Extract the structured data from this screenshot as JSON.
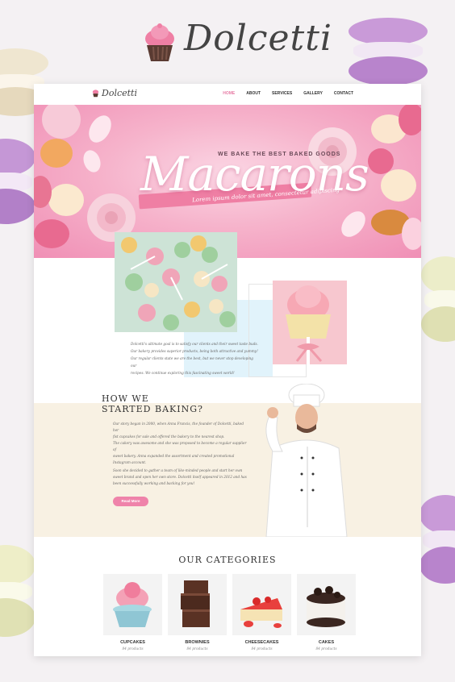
{
  "brand": {
    "name": "Dolcetti",
    "icon": "cupcake-icon"
  },
  "nav": {
    "logo": "Dolcetti",
    "links": [
      "HOME",
      "ABOUT",
      "SERVICES",
      "GALLERY",
      "CONTACT"
    ],
    "active": "HOME"
  },
  "hero": {
    "subtitle": "WE BAKE THE BEST BAKED GOODS",
    "title": "Macarons",
    "tagline": "Lorem ipsum dolor sit amet, consectetur adipiscing"
  },
  "about": {
    "lines": [
      "Dolcetti's ultimate goal is to satisfy our clients and their sweet taste buds.",
      "Our bakery provides superior products, being both attractive and yummy!",
      "Our regular clients state we are the best, but we never stop developing our",
      "recipes. We continue exploring this fascinating sweet world!"
    ]
  },
  "story": {
    "title_line1": "HOW WE",
    "title_line2": "STARTED BAKING?",
    "p1": [
      "Our story began in 2000, when Anna Francis, the founder of Dolcetti, baked her",
      "fist cupcakes for sale and offered the bakery to the nearest shop."
    ],
    "p2": [
      "The cakery was awesome and she was proposed to become a regular supplier of",
      "sweet bakery. Anna expanded the assortment and created promotional",
      "Instagram account."
    ],
    "p3": [
      "Soon she decided to gather a team of like-minded people and start her own",
      "sweet brand and open her own store. Dolcetti itself appeared in 2012 and has",
      "been successfully working and backing for you!"
    ],
    "button": "Read More"
  },
  "categories": {
    "title": "OUR CATEGORIES",
    "items": [
      {
        "name": "CUPCAKES",
        "count": "84 products"
      },
      {
        "name": "BROWNIES",
        "count": "84 products"
      },
      {
        "name": "CHEESECAKES",
        "count": "84 products"
      },
      {
        "name": "CAKES",
        "count": "84 products"
      }
    ]
  },
  "colors": {
    "accent": "#ef83aa",
    "hero_pink": "#f6b3cb",
    "story_bg": "#f8f1e3"
  }
}
